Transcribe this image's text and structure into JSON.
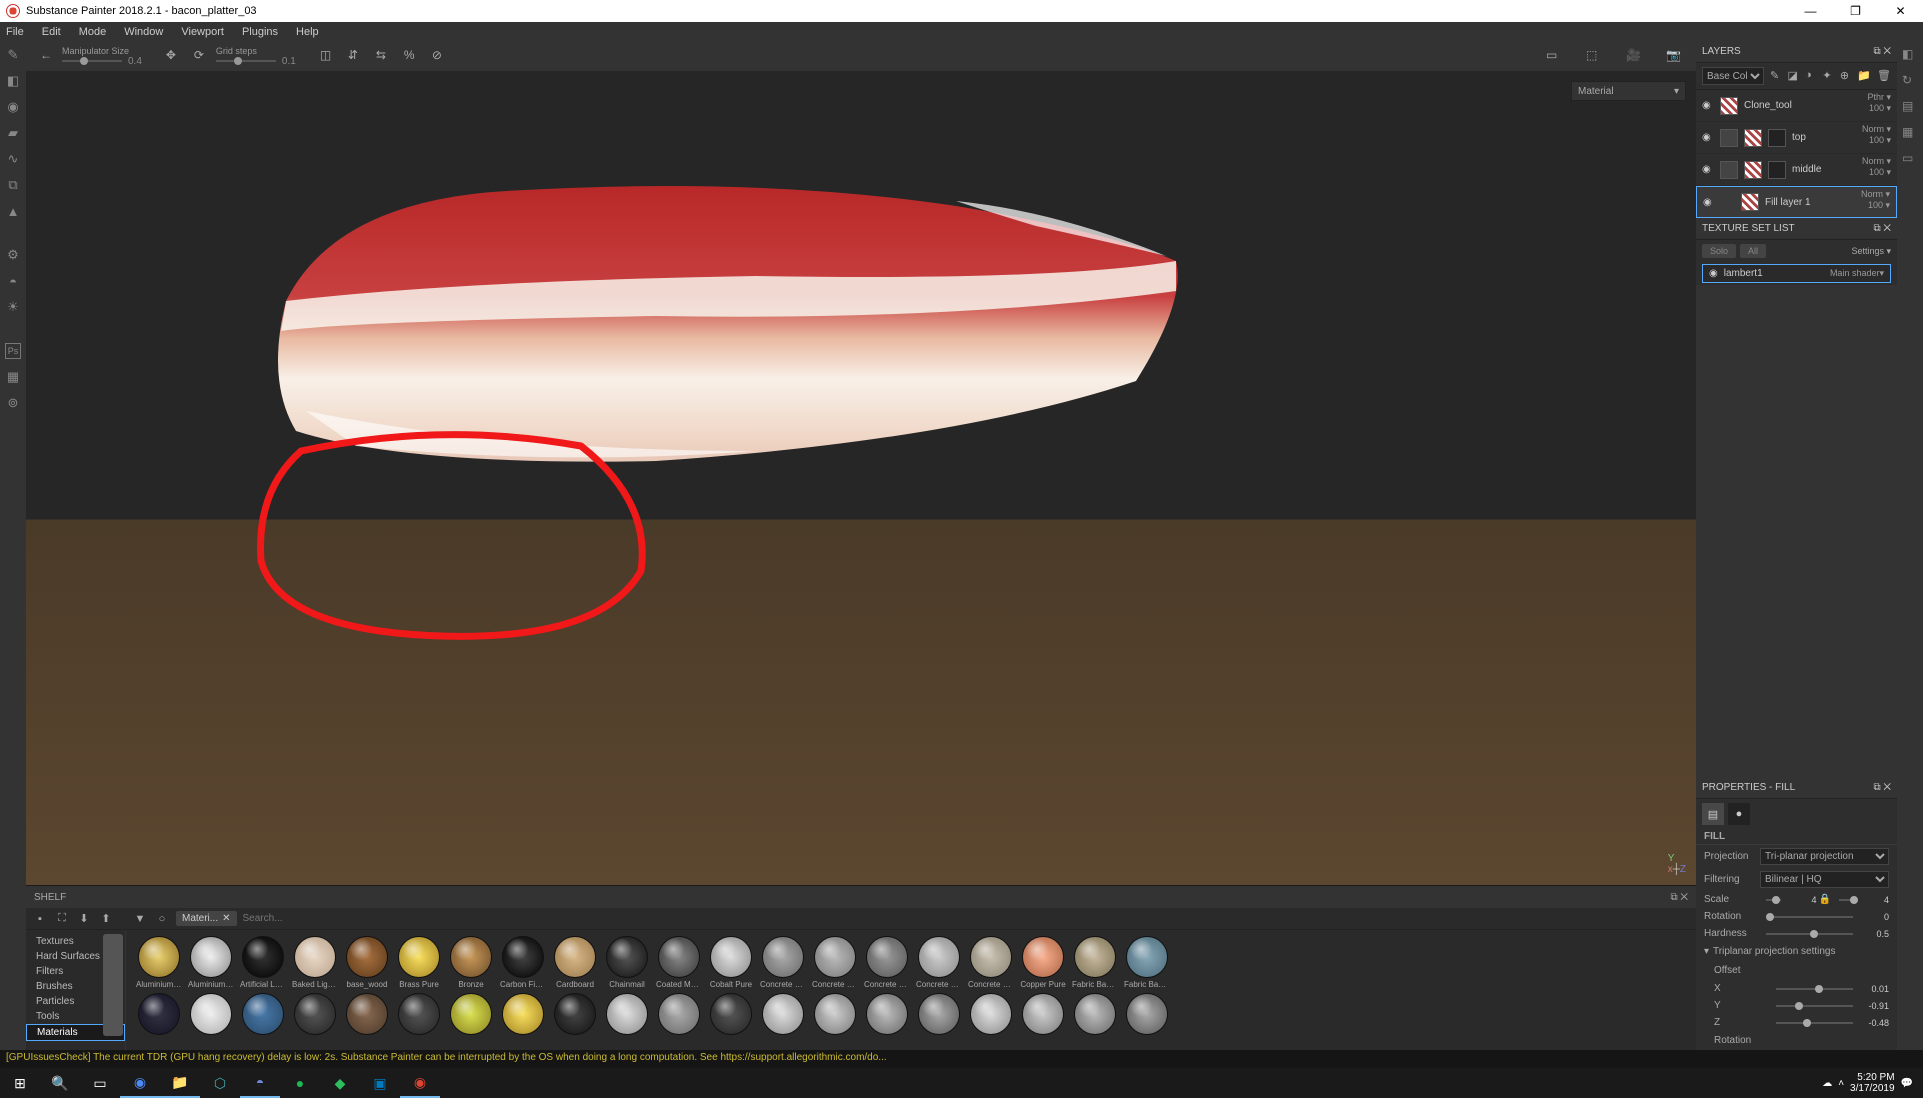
{
  "title": "Substance Painter 2018.2.1 - bacon_platter_03",
  "menu": [
    "File",
    "Edit",
    "Mode",
    "Window",
    "Viewport",
    "Plugins",
    "Help"
  ],
  "toptool": {
    "manip_label": "Manipulator Size",
    "manip_val": "0.4",
    "grid_label": "Grid steps",
    "grid_val": "0.1"
  },
  "viewport": {
    "material_dropdown": "Material"
  },
  "axis": {
    "y": "Y",
    "x": "x",
    "z": "Z"
  },
  "shelf": {
    "title": "SHELF",
    "tag": "Materi...",
    "search_ph": "Search...",
    "cats": [
      "Textures",
      "Hard Surfaces",
      "Filters",
      "Brushes",
      "Particles",
      "Tools",
      "Materials"
    ],
    "cat_sel": 6,
    "row1": [
      {
        "n": "Aluminium ...",
        "c1": "#e8d070",
        "c2": "#8a6a20"
      },
      {
        "n": "Aluminium ...",
        "c1": "#eee",
        "c2": "#888"
      },
      {
        "n": "Artificial Lea...",
        "c1": "#333",
        "c2": "#000"
      },
      {
        "n": "Baked Light...",
        "c1": "#e8d8c8",
        "c2": "#b8a088"
      },
      {
        "n": "base_wood",
        "c1": "#a87040",
        "c2": "#5a3818"
      },
      {
        "n": "Brass Pure",
        "c1": "#f8e060",
        "c2": "#a08020"
      },
      {
        "n": "Bronze",
        "c1": "#c89858",
        "c2": "#6a4a28"
      },
      {
        "n": "Carbon Fiber",
        "c1": "#444",
        "c2": "#000"
      },
      {
        "n": "Cardboard",
        "c1": "#d8b888",
        "c2": "#987848"
      },
      {
        "n": "Chainmail",
        "c1": "#555",
        "c2": "#111"
      },
      {
        "n": "Coated Metal",
        "c1": "#888",
        "c2": "#333"
      },
      {
        "n": "Cobalt Pure",
        "c1": "#ddd",
        "c2": "#888"
      },
      {
        "n": "Concrete B...",
        "c1": "#aaa",
        "c2": "#666"
      },
      {
        "n": "Concrete Cl...",
        "c1": "#bbb",
        "c2": "#777"
      },
      {
        "n": "Concrete D...",
        "c1": "#999",
        "c2": "#555"
      },
      {
        "n": "Concrete Si...",
        "c1": "#ccc",
        "c2": "#888"
      },
      {
        "n": "Concrete S...",
        "c1": "#c8c0b0",
        "c2": "#888070"
      },
      {
        "n": "Copper Pure",
        "c1": "#f8b090",
        "c2": "#a86040"
      },
      {
        "n": "Fabric Bam...",
        "c1": "#c8b8a0",
        "c2": "#787050"
      },
      {
        "n": "Fabric Base...",
        "c1": "#88a8b8",
        "c2": "#486878"
      }
    ],
    "row2_colors": [
      [
        "#334",
        "#112"
      ],
      [
        "#eee",
        "#aaa"
      ],
      [
        "#4878a8",
        "#284868"
      ],
      [
        "#555",
        "#222"
      ],
      [
        "#886850",
        "#483828"
      ],
      [
        "#555",
        "#222"
      ],
      [
        "#d8e050",
        "#888020"
      ],
      [
        "#f8e060",
        "#a08020"
      ],
      [
        "#444",
        "#111"
      ],
      [
        "#ddd",
        "#888"
      ],
      [
        "#aaa",
        "#666"
      ],
      [
        "#555",
        "#222"
      ],
      [
        "#ddd",
        "#888"
      ],
      [
        "#ccc",
        "#777"
      ],
      [
        "#bbb",
        "#666"
      ],
      [
        "#aaa",
        "#555"
      ],
      [
        "#ddd",
        "#888"
      ],
      [
        "#ccc",
        "#777"
      ],
      [
        "#bbb",
        "#666"
      ],
      [
        "#aaa",
        "#555"
      ]
    ]
  },
  "layers": {
    "title": "LAYERS",
    "blend": "Base Cok",
    "items": [
      {
        "name": "Clone_tool",
        "mode": "Pthr",
        "op": "100",
        "thumbs": [
          "tex"
        ]
      },
      {
        "name": "top",
        "mode": "Norm",
        "op": "100",
        "thumbs": [
          "fold",
          "tex",
          "dark"
        ]
      },
      {
        "name": "middle",
        "mode": "Norm",
        "op": "100",
        "thumbs": [
          "fold",
          "tex",
          "dark"
        ]
      },
      {
        "name": "Fill layer 1",
        "mode": "Norm",
        "op": "100",
        "thumbs": [
          "tex"
        ],
        "sel": true,
        "indent": true
      }
    ]
  },
  "texset": {
    "title": "TEXTURE SET LIST",
    "solo": "Solo",
    "all": "All",
    "settings": "Settings",
    "item": "lambert1",
    "shader": "Main shader"
  },
  "props": {
    "title": "PROPERTIES - FILL",
    "fill": "FILL",
    "projection_l": "Projection",
    "projection_v": "Tri-planar projection",
    "filtering_l": "Filtering",
    "filtering_v": "Bilinear | HQ",
    "scale_l": "Scale",
    "scale_v1": "4",
    "scale_v2": "4",
    "rotation_l": "Rotation",
    "rotation_v": "0",
    "hardness_l": "Hardness",
    "hardness_v": "0.5",
    "tri_title": "Triplanar projection settings",
    "offset_l": "Offset",
    "x_l": "X",
    "x_v": "0.01",
    "y_l": "Y",
    "y_v": "-0.91",
    "z_l": "Z",
    "z_v": "-0.48",
    "rot2_l": "Rotation"
  },
  "status": "[GPUIssuesCheck] The current TDR (GPU hang recovery) delay is low: 2s. Substance Painter can be interrupted by the OS when doing a long computation. See https://support.allegorithmic.com/do...",
  "tray": {
    "time": "5:20 PM",
    "date": "3/17/2019"
  }
}
